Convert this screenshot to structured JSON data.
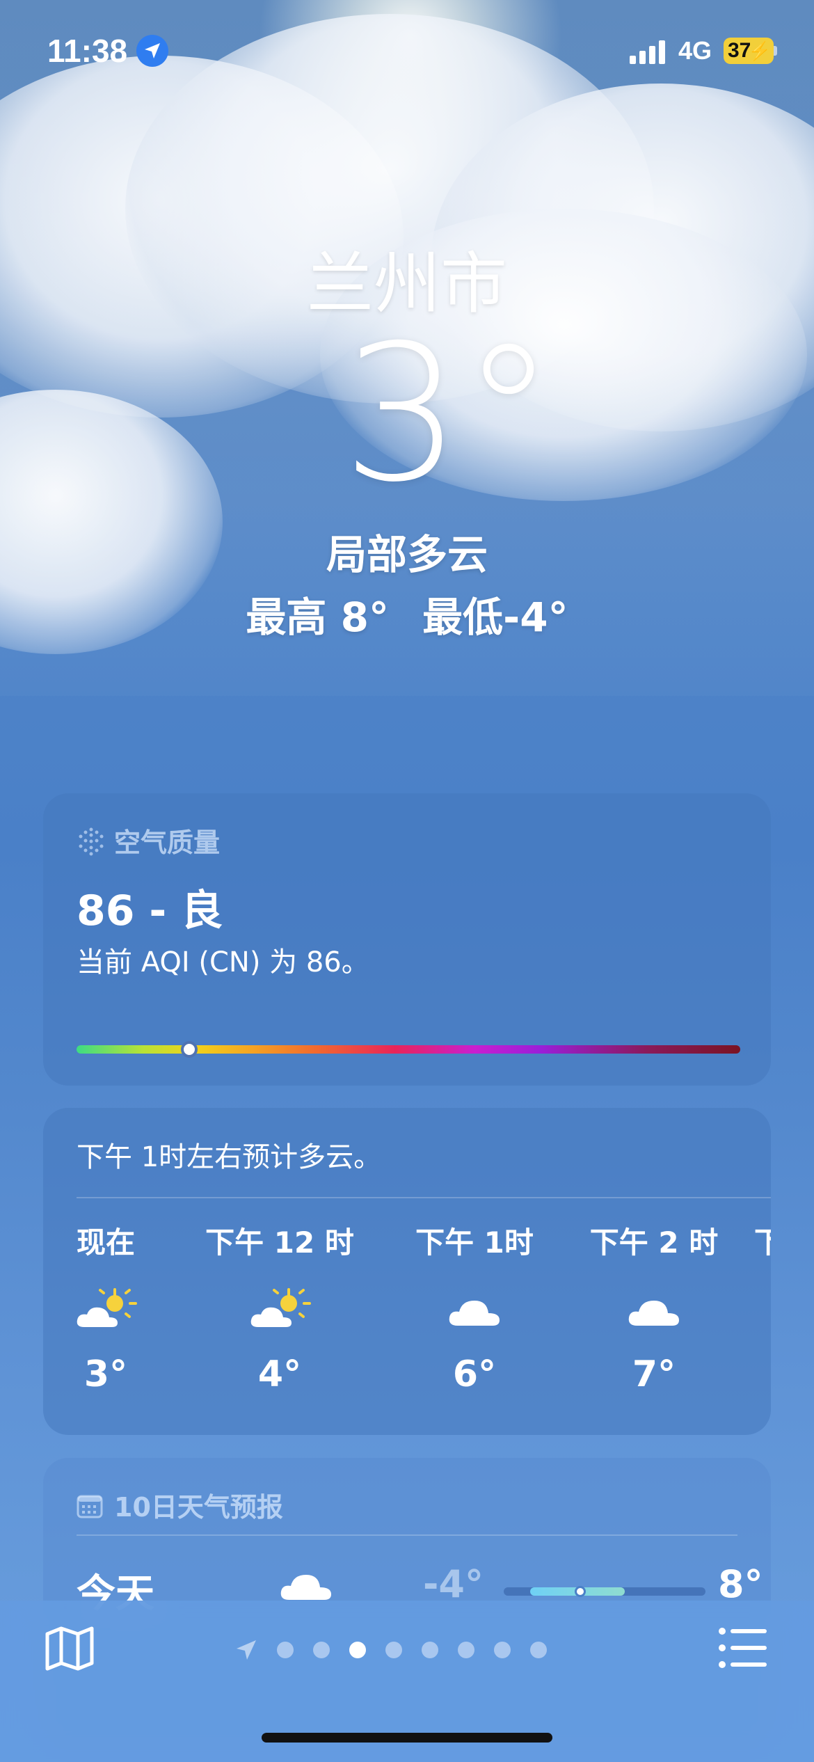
{
  "status_bar": {
    "time": "11:38",
    "network": "4G",
    "battery": "37",
    "icons": [
      "location-arrow-icon",
      "cellular-signal-icon",
      "battery-charging-icon"
    ]
  },
  "header": {
    "city": "兰州市",
    "temperature": "3°",
    "condition": "局部多云",
    "high": "最高 8°",
    "low": "最低-4°"
  },
  "air_quality": {
    "title": "空气质量",
    "value": "86 - 良",
    "description": "当前 AQI (CN) 为 86。",
    "aqi": 86,
    "scale_position": 0.17
  },
  "hourly": {
    "summary": "下午 1时左右预计多云。",
    "items": [
      {
        "label": "现在",
        "icon": "partly-cloudy-sun-icon",
        "temp": "3°"
      },
      {
        "label": "下午 12 时",
        "icon": "partly-cloudy-sun-icon",
        "temp": "4°"
      },
      {
        "label": "下午 1时",
        "icon": "cloud-icon",
        "temp": "6°"
      },
      {
        "label": "下午 2 时",
        "icon": "cloud-icon",
        "temp": "7°"
      },
      {
        "label": "下",
        "icon": "cloud-icon",
        "temp": ""
      }
    ]
  },
  "ten_day": {
    "title": "10日天气预报",
    "days": [
      {
        "name": "今天",
        "icon": "cloud-icon",
        "low": "-4°",
        "high": "8°",
        "range_start": 0.13,
        "range_end": 0.6,
        "current": 0.38
      }
    ]
  },
  "toolbar": {
    "page_count": 8,
    "active_page": 3,
    "icons": [
      "map-icon",
      "location-arrow-icon",
      "list-icon"
    ]
  },
  "colors": {
    "location_badge": "#2f7df0",
    "battery": "#f2cf3a"
  }
}
